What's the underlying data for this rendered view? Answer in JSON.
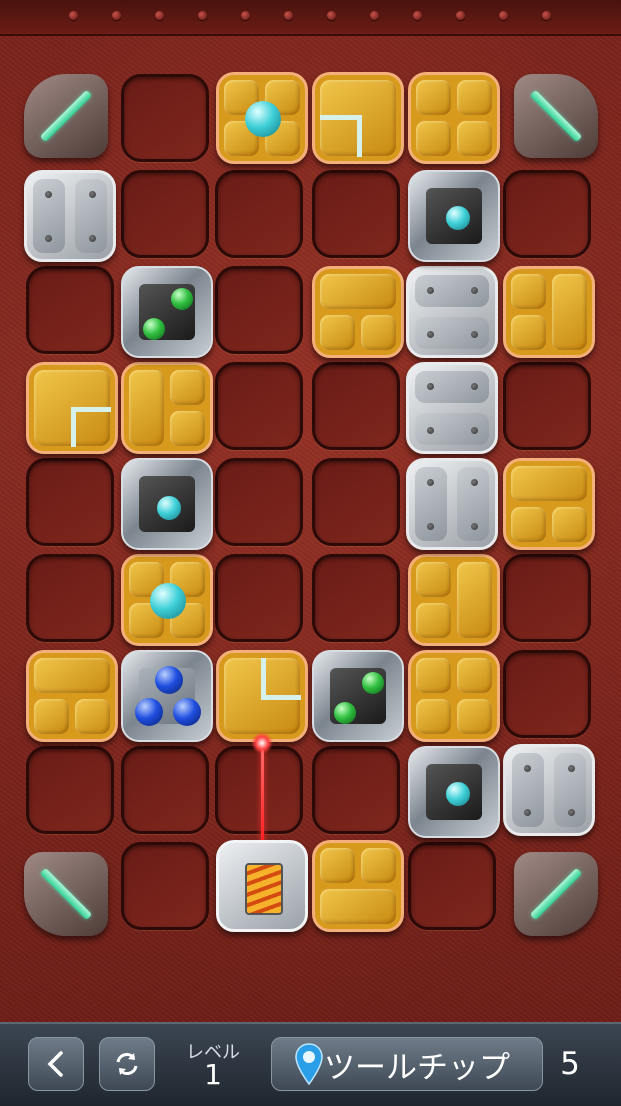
{
  "level": {
    "label": "レベル",
    "number": "1"
  },
  "tooltip": {
    "label": "ツールチップ",
    "count": "5"
  },
  "colors": {
    "gold": "#d89a1c",
    "laser": "#ff2020",
    "mirror": "#2fcf93",
    "cyan_ball": "#3fd0d8",
    "green_ball": "#30c040",
    "blue_ball": "#1f4fe0"
  },
  "board": {
    "columns": 6,
    "rows": 9
  },
  "icons": {
    "back": "chevron-left-icon",
    "restart": "rotate-arrows-icon",
    "tooltip": "map-pin-icon"
  }
}
